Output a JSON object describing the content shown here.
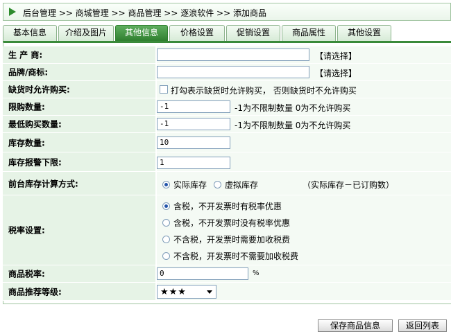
{
  "breadcrumb": "后台管理 >> 商城管理 >> 商品管理 >> 逐浪软件 >> 添加商品",
  "tabs": [
    "基本信息",
    "介绍及图片",
    "其他信息",
    "价格设置",
    "促销设置",
    "商品属性",
    "其他设置"
  ],
  "active_tab": "其他信息",
  "form": {
    "maker": {
      "label": "生 产 商:",
      "value": "",
      "action": "【请选择】"
    },
    "brand": {
      "label": "品牌/商标:",
      "value": "",
      "action": "【请选择】"
    },
    "stockout": {
      "label": "缺货时允许购买:",
      "hint": "打勾表示缺货时允许购买， 否则缺货时不允许购买",
      "checked": false
    },
    "limit_qty": {
      "label": "限购数量:",
      "value": "-1",
      "hint": "-1为不限制数量 0为不允许购买"
    },
    "min_qty": {
      "label": "最低购买数量:",
      "value": "-1",
      "hint": "-1为不限制数量 0为不允许购买"
    },
    "stock": {
      "label": "库存数量:",
      "value": "10"
    },
    "stock_alert": {
      "label": "库存报警下限:",
      "value": "1"
    },
    "stock_calc": {
      "label": "前台库存计算方式:",
      "options": [
        "实际库存",
        "虚拟库存"
      ],
      "selected": 0,
      "note": "（实际库存－已订购数）"
    },
    "tax": {
      "label": "税率设置:",
      "options": [
        "含税，不开发票时有税率优惠",
        "含税，不开发票时没有税率优惠",
        "不含税，开发票时需要加收税费",
        "不含税，开发票时不需要加收税费"
      ],
      "selected": 0
    },
    "tax_rate": {
      "label": "商品税率:",
      "value": "0",
      "unit": "%"
    },
    "recommend": {
      "label": "商品推荐等级:",
      "value": "★★★"
    }
  },
  "buttons": {
    "save": "保存商品信息",
    "back": "返回列表"
  }
}
